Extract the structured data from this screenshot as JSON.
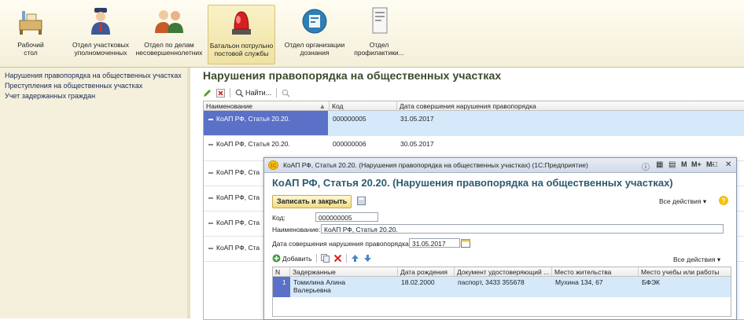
{
  "toolbar": {
    "buttons": [
      {
        "label": "Рабочий\nстол"
      },
      {
        "label": "Отдел участковых\nуполномоченных"
      },
      {
        "label": "Отдел по делам\nнесовершеннолетних"
      },
      {
        "label": "Батальон потрульно\nпостовой службы"
      },
      {
        "label": "Отдел организации\nдознания"
      },
      {
        "label": "Отдел\nпрофилактики..."
      }
    ]
  },
  "leftnav": {
    "items": [
      {
        "label": "Нарушения правопорядка на общественных участках"
      },
      {
        "label": "Преступления на общественных участках"
      },
      {
        "label": "Учет задержанных граждан"
      }
    ]
  },
  "main": {
    "title": "Нарушения правопорядка на общественных участках",
    "find_label": "Найти...",
    "columns": [
      "Наименование",
      "Код",
      "Дата совершения нарушения правопорядка"
    ],
    "rows": [
      {
        "name": "КоАП РФ, Статья 20.20.",
        "code": "000000005",
        "date": "31.05.2017"
      },
      {
        "name": "КоАП РФ, Статья 20.20.",
        "code": "000000006",
        "date": "30.05.2017"
      },
      {
        "name": "КоАП РФ, Ста",
        "code": "",
        "date": ""
      },
      {
        "name": "КоАП РФ, Ста",
        "code": "",
        "date": ""
      },
      {
        "name": "КоАП РФ, Ста",
        "code": "",
        "date": ""
      },
      {
        "name": "КоАП РФ, Ста",
        "code": "",
        "date": ""
      }
    ]
  },
  "dialog": {
    "title": "КоАП РФ, Статья 20.20. (Нарушения правопорядка на общественных участках) (1С:Предприятие)",
    "title_controls": {
      "m": "M",
      "mplus": "M+",
      "mminus": "M-",
      "max": "□",
      "close": "✕"
    },
    "heading": "КоАП РФ, Статья 20.20. (Нарушения правопорядка на общественных участках)",
    "save_close": "Записать и закрыть",
    "all_actions": "Все действия",
    "help": "?",
    "code_label": "Код:",
    "code_value": "000000005",
    "name_label": "Наименование:",
    "name_value": "КоАП РФ, Статья 20.20.",
    "date_label": "Дата совершения нарушения правопорядка:",
    "date_value": "31.05.2017",
    "add_label": "Добавить",
    "all_actions2": "Все действия",
    "sub_columns": [
      "N",
      "Задержанные",
      "Дата рождения",
      "Документ удостоверяющий ...",
      "Место жительства",
      "Место учебы или работы"
    ],
    "sub_rows": [
      {
        "n": "1",
        "person": "Томилина Алина Валерьевна",
        "birth": "18.02.2000",
        "doc": "паспорт, 3433 355678",
        "address": "Мухина 134, 67",
        "work": "БФЭК"
      }
    ]
  },
  "colors": {
    "accent": "#2d5a70",
    "selection": "#d6e9fb",
    "save_button": "#f1dc85"
  }
}
